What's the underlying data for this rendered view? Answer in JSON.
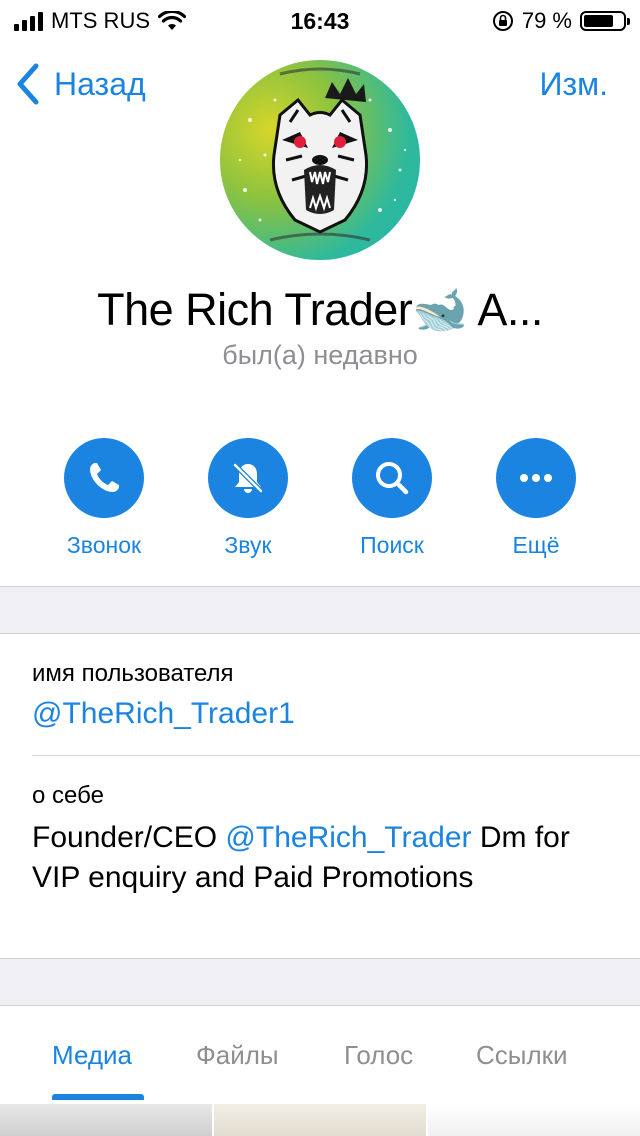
{
  "status_bar": {
    "carrier": "MTS RUS",
    "time": "16:43",
    "battery_percent": "79 %",
    "battery_level": 0.79
  },
  "nav": {
    "back_label": "Назад",
    "edit_label": "Изм."
  },
  "profile": {
    "name": "The Rich Trader🐋 A...",
    "last_seen": "был(а) недавно"
  },
  "actions": [
    {
      "label": "Звонок",
      "icon": "phone-icon"
    },
    {
      "label": "Звук",
      "icon": "bell-slash-icon"
    },
    {
      "label": "Поиск",
      "icon": "search-icon"
    },
    {
      "label": "Ещё",
      "icon": "more-icon"
    }
  ],
  "info": {
    "username_label": "имя пользователя",
    "username_value": "@TheRich_Trader1",
    "about_label": "о себе",
    "about_prefix": "Founder/CEO ",
    "about_mention": "@TheRich_Trader",
    "about_suffix": " Dm for VIP enquiry and Paid Promotions"
  },
  "tabs": [
    {
      "label": "Медиа",
      "active": true
    },
    {
      "label": "Файлы",
      "active": false
    },
    {
      "label": "Голос",
      "active": false
    },
    {
      "label": "Ссылки",
      "active": false
    }
  ],
  "colors": {
    "accent": "#1a84e0",
    "secondary_text": "#8e8e93",
    "separator_bg": "#efeff4"
  }
}
